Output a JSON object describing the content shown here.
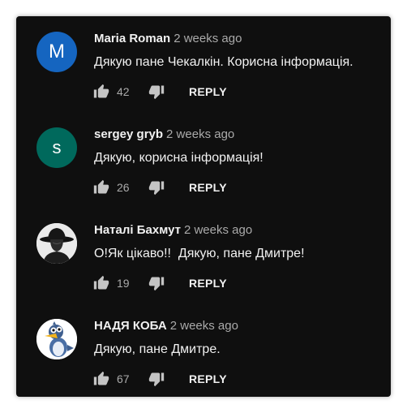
{
  "colors": {
    "panel_background": "#0f0f0f",
    "author_text": "#f1f1f1",
    "meta_text": "#aaaaaa",
    "icon": "#c4c4c4"
  },
  "comments": [
    {
      "author": "Maria Roman",
      "time": "2 weeks ago",
      "text": "Дякую пане Чекалкін. Корисна інформація.",
      "likes": "42",
      "reply_label": "REPLY",
      "avatar": {
        "type": "letter",
        "letter": "M",
        "color": "#1565c0"
      }
    },
    {
      "author": "sergey gryb",
      "time": "2 weeks ago",
      "text": "Дякую, корисна інформація!",
      "likes": "26",
      "reply_label": "REPLY",
      "avatar": {
        "type": "letter",
        "letter": "s",
        "color": "#00695c"
      }
    },
    {
      "author": "Наталі Бахмут",
      "time": "2 weeks ago",
      "text": "О!Як цікаво!!  Дякую, пане Дмитре!",
      "likes": "19",
      "reply_label": "REPLY",
      "avatar": {
        "type": "image",
        "icon": "hat-silhouette-icon"
      }
    },
    {
      "author": "НАДЯ КОБА",
      "time": "2 weeks ago",
      "text": "Дякую, пане Дмитре.",
      "likes": "67",
      "reply_label": "REPLY",
      "avatar": {
        "type": "image",
        "icon": "cartoon-bird-icon"
      }
    }
  ]
}
